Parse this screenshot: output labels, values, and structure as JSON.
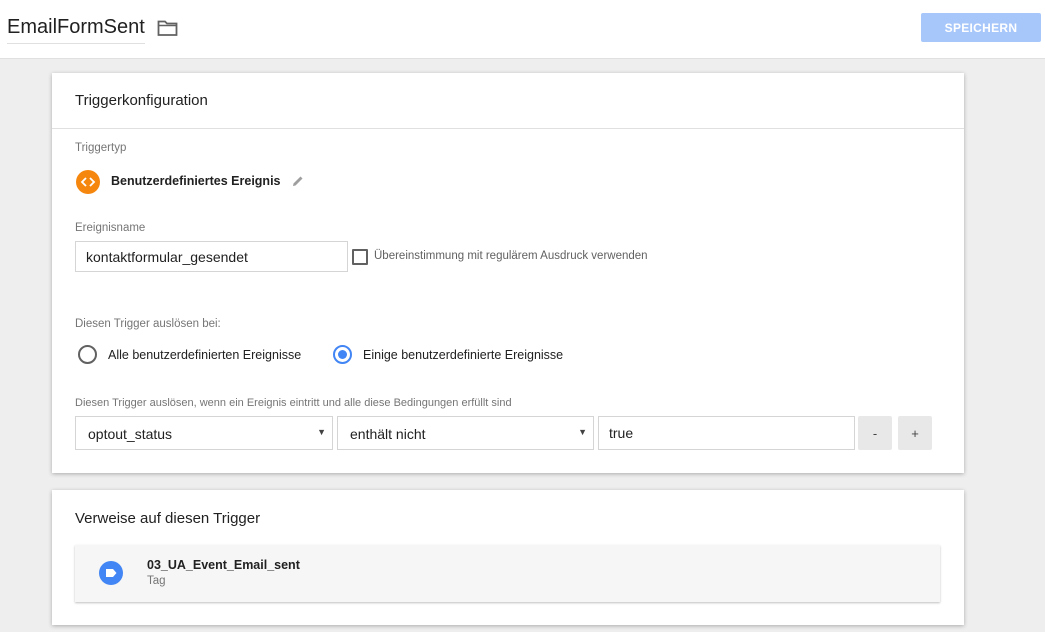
{
  "header": {
    "title": "EmailFormSent",
    "save_label": "SPEICHERN"
  },
  "config": {
    "card_title": "Triggerkonfiguration",
    "trigger_type_label": "Triggertyp",
    "trigger_type_name": "Benutzerdefiniertes Ereignis",
    "event_name_label": "Ereignisname",
    "event_name_value": "kontaktformular_gesendet",
    "regex_label": "Übereinstimmung mit regulärem Ausdruck verwenden",
    "regex_checked": false,
    "fire_on_label": "Diesen Trigger auslösen bei:",
    "fire_options": [
      {
        "label": "Alle benutzerdefinierten Ereignisse",
        "checked": false
      },
      {
        "label": "Einige benutzerdefinierte Ereignisse",
        "checked": true
      }
    ],
    "conditions_label": "Diesen Trigger auslösen, wenn ein Ereignis eintritt und alle diese Bedingungen erfüllt sind",
    "condition": {
      "variable": "optout_status",
      "operator": "enthält nicht",
      "value": "true"
    },
    "remove_label": "-",
    "add_label": "+"
  },
  "references": {
    "card_title": "Verweise auf diesen Trigger",
    "items": [
      {
        "name": "03_UA_Event_Email_sent",
        "type": "Tag"
      }
    ]
  },
  "colors": {
    "accent": "#4285f4",
    "save_button": "#a7c7fb",
    "trigger_icon": "#f6870e"
  },
  "icons": {
    "folder": "folder-icon",
    "trigger_type": "custom-event-icon",
    "edit": "pencil-icon",
    "tag": "tag-icon"
  }
}
